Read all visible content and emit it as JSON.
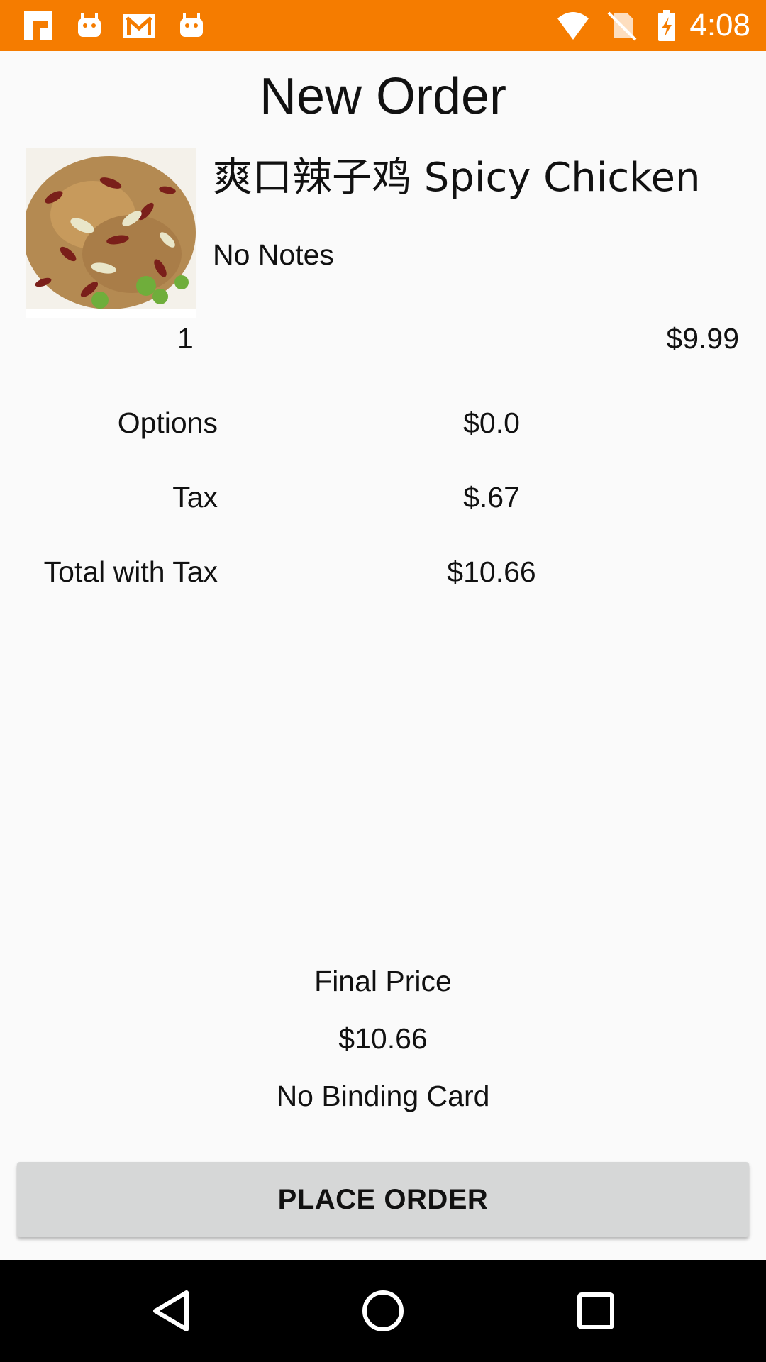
{
  "status_bar": {
    "time": "4:08",
    "color": "#f57c00",
    "left_icons": [
      "flipboard-icon",
      "android-icon",
      "gmail-icon",
      "android-icon"
    ],
    "right_icons": [
      "wifi-icon",
      "no-sim-icon",
      "battery-charging-icon"
    ]
  },
  "page": {
    "title": "New Order"
  },
  "order_item": {
    "name": "爽口辣子鸡 Spicy Chicken",
    "notes": "No Notes",
    "quantity": "1",
    "price": "$9.99"
  },
  "summary": {
    "options_label": "Options",
    "options_value": "$0.0",
    "tax_label": "Tax",
    "tax_value": "$.67",
    "total_label": "Total with Tax",
    "total_value": "$10.66"
  },
  "final": {
    "label": "Final Price",
    "price": "$10.66",
    "card_status": "No Binding Card"
  },
  "actions": {
    "place_order_label": "PLACE ORDER"
  },
  "nav_bar": {
    "buttons": [
      "back-icon",
      "home-icon",
      "recents-icon"
    ]
  }
}
